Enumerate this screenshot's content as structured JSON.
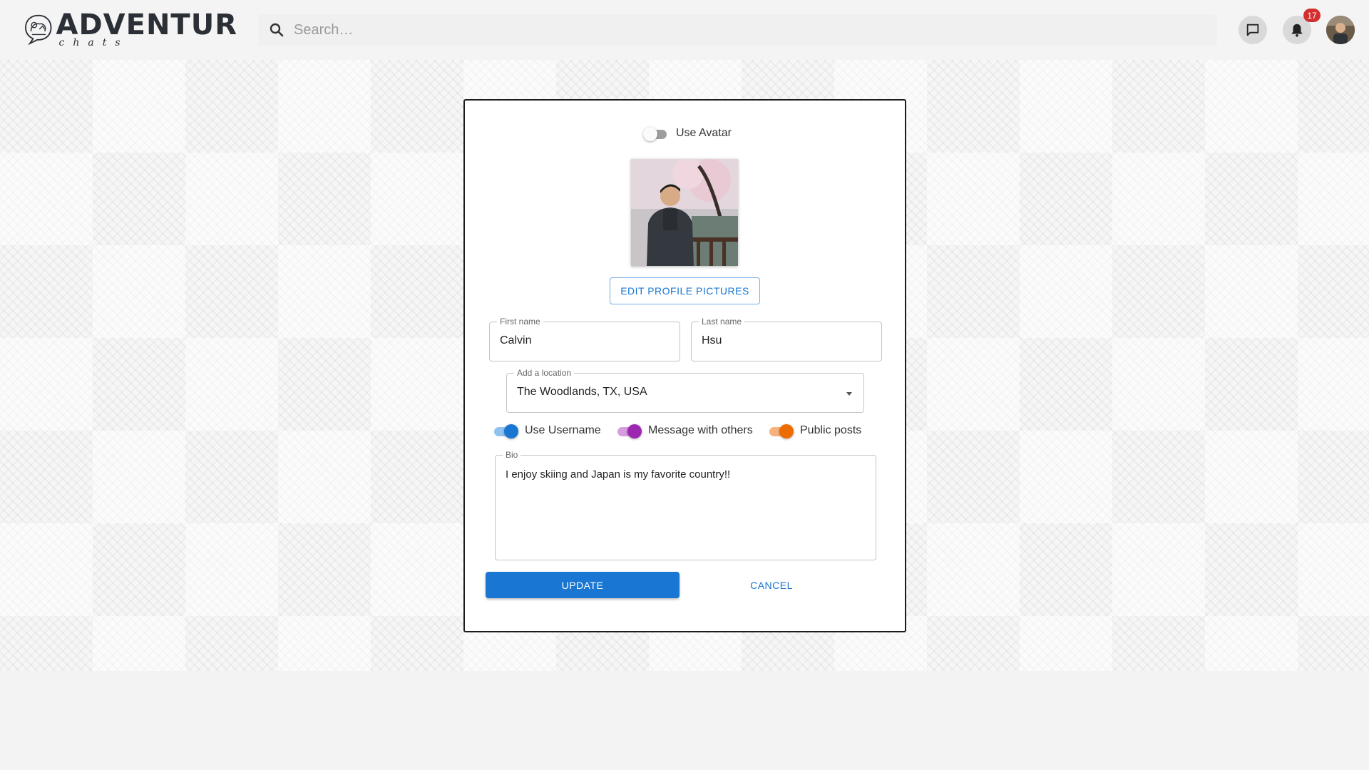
{
  "header": {
    "logo_title": "ADVENTUR",
    "logo_subtitle": "chats",
    "search_placeholder": "Search…",
    "chat_icon": "chat-icon",
    "bell_icon": "bell-icon",
    "notification_count": "17"
  },
  "profile_form": {
    "use_avatar_label": "Use Avatar",
    "use_avatar_on": false,
    "edit_pictures_label": "EDIT PROFILE PICTURES",
    "first_name": {
      "label": "First name",
      "value": "Calvin"
    },
    "last_name": {
      "label": "Last name",
      "value": "Hsu"
    },
    "location": {
      "label": "Add a location",
      "value": "The Woodlands, TX, USA"
    },
    "toggles": [
      {
        "label": "Use Username",
        "on": true,
        "color": "#1976d2"
      },
      {
        "label": "Message with others",
        "on": true,
        "color": "#9c27b0"
      },
      {
        "label": "Public posts",
        "on": true,
        "color": "#ed6c02"
      }
    ],
    "bio": {
      "label": "Bio",
      "value": "I enjoy skiing and Japan is my favorite country!!"
    },
    "update_label": "UPDATE",
    "cancel_label": "CANCEL"
  },
  "colors": {
    "primary": "#1976d2",
    "badge": "#d32f2f"
  }
}
